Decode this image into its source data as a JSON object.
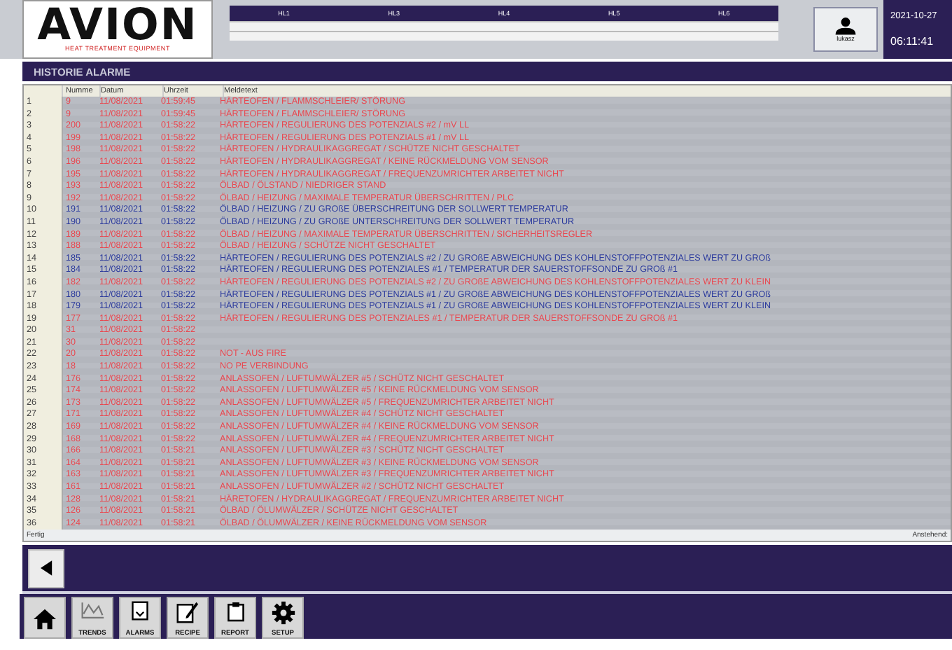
{
  "header": {
    "logo": {
      "name": "AVION",
      "tagline": "HEAT TREATMENT EQUIPMENT"
    },
    "hl_table": {
      "columns": [
        "HL1",
        "HL3",
        "HL4",
        "HL5",
        "HL6"
      ]
    },
    "user_button": {
      "label": "lukasz"
    },
    "clock": {
      "date": "2021-10-27",
      "time": "06:11:41"
    }
  },
  "page_title": "HISTORIE ALARME",
  "table": {
    "columns": [
      "Numme",
      "Datum",
      "Uhrzeit",
      "Meldetext"
    ],
    "rows": [
      {
        "index": "1",
        "number": "9",
        "date": "11/08/2021",
        "time": "01:59:45",
        "text": "HÄRTEOFEN / FLAMMSCHLEIER/ STÖRUNG",
        "color": "#e8474f"
      },
      {
        "index": "2",
        "number": "9",
        "date": "11/08/2021",
        "time": "01:59:45",
        "text": "HÄRTEOFEN / FLAMMSCHLEIER/ STÖRUNG",
        "color": "#e8474f"
      },
      {
        "index": "3",
        "number": "200",
        "date": "11/08/2021",
        "time": "01:58:22",
        "text": "HÄRTEOFEN / REGULIERUNG DES POTENZIALS #2 / mV LL",
        "color": "#e8474f"
      },
      {
        "index": "4",
        "number": "199",
        "date": "11/08/2021",
        "time": "01:58:22",
        "text": "HÄRTEOFEN / REGULIERUNG DES POTENZIALS #1 / mV LL",
        "color": "#e8474f"
      },
      {
        "index": "5",
        "number": "198",
        "date": "11/08/2021",
        "time": "01:58:22",
        "text": "HÄRTEOFEN / HYDRAULIKAGGREGAT / SCHÜTZE NICHT GESCHALTET",
        "color": "#e8474f"
      },
      {
        "index": "6",
        "number": "196",
        "date": "11/08/2021",
        "time": "01:58:22",
        "text": "HÄRTEOFEN / HYDRAULIKAGGREGAT / KEINE RÜCKMELDUNG VOM SENSOR",
        "color": "#e8474f"
      },
      {
        "index": "7",
        "number": "195",
        "date": "11/08/2021",
        "time": "01:58:22",
        "text": "HÄRTEOFEN / HYDRAULIKAGGREGAT / FREQUENZUMRICHTER ARBEITET NICHT",
        "color": "#e8474f"
      },
      {
        "index": "8",
        "number": "193",
        "date": "11/08/2021",
        "time": "01:58:22",
        "text": "ÖLBAD / ÖLSTAND / NIEDRIGER STAND",
        "color": "#e8474f"
      },
      {
        "index": "9",
        "number": "192",
        "date": "11/08/2021",
        "time": "01:58:22",
        "text": "ÖLBAD / HEIZUNG / MAXIMALE TEMPERATUR ÜBERSCHRITTEN / PLC",
        "color": "#e8474f"
      },
      {
        "index": "10",
        "number": "191",
        "date": "11/08/2021",
        "time": "01:58:22",
        "text": "ÖLBAD / HEIZUNG / ZU GROßE ÜBERSCHREITUNG DER SOLLWERT TEMPERATUR",
        "color": "#2b3a9c"
      },
      {
        "index": "11",
        "number": "190",
        "date": "11/08/2021",
        "time": "01:58:22",
        "text": "ÖLBAD / HEIZUNG / ZU GROßE UNTERSCHREITUNG DER SOLLWERT TEMPERATUR",
        "color": "#2b3a9c"
      },
      {
        "index": "12",
        "number": "189",
        "date": "11/08/2021",
        "time": "01:58:22",
        "text": "ÖLBAD / HEIZUNG / MAXIMALE TEMPERATUR ÜBERSCHRITTEN / SICHERHEITSREGLER",
        "color": "#e8474f"
      },
      {
        "index": "13",
        "number": "188",
        "date": "11/08/2021",
        "time": "01:58:22",
        "text": "ÖLBAD / HEIZUNG / SCHÜTZE NICHT GESCHALTET",
        "color": "#e8474f"
      },
      {
        "index": "14",
        "number": "185",
        "date": "11/08/2021",
        "time": "01:58:22",
        "text": "HÄRTEOFEN / REGULIERUNG DES POTENZIALS #2 / ZU GROßE ABWEICHUNG DES KOHLENSTOFFPOTENZIALES WERT ZU GROß",
        "color": "#2b3a9c"
      },
      {
        "index": "15",
        "number": "184",
        "date": "11/08/2021",
        "time": "01:58:22",
        "text": "HÄRTEOFEN / REGULIERUNG DES POTENZIALES #1 / TEMPERATUR DER SAUERSTOFFSONDE ZU GROß #1",
        "color": "#2b3a9c"
      },
      {
        "index": "16",
        "number": "182",
        "date": "11/08/2021",
        "time": "01:58:22",
        "text": "HÄRTEOFEN / REGULIERUNG DES POTENZIALS #2 / ZU GROßE ABWEICHUNG DES KOHLENSTOFFPOTENZIALES WERT ZU KLEIN",
        "color": "#e8474f"
      },
      {
        "index": "17",
        "number": "180",
        "date": "11/08/2021",
        "time": "01:58:22",
        "text": "HÄRTEOFEN / REGULIERUNG DES POTENZIALS #1 / ZU GROßE ABWEICHUNG DES KOHLENSTOFFPOTENZIALES WERT ZU GROß",
        "color": "#2b3a9c"
      },
      {
        "index": "18",
        "number": "179",
        "date": "11/08/2021",
        "time": "01:58:22",
        "text": "HÄRTEOFEN / REGULIERUNG DES POTENZIALS #1 / ZU GROßE ABWEICHUNG DES KOHLENSTOFFPOTENZIALES WERT ZU KLEIN",
        "color": "#2b3a9c"
      },
      {
        "index": "19",
        "number": "177",
        "date": "11/08/2021",
        "time": "01:58:22",
        "text": "HÄRTEOFEN / REGULIERUNG DES POTENZIALES #1 / TEMPERATUR DER SAUERSTOFFSONDE ZU GROß #1",
        "color": "#e8474f"
      },
      {
        "index": "20",
        "number": "31",
        "date": "11/08/2021",
        "time": "01:58:22",
        "color": "#e8474f"
      },
      {
        "index": "21",
        "number": "30",
        "date": "11/08/2021",
        "time": "01:58:22",
        "color": "#e8474f"
      },
      {
        "index": "22",
        "number": "20",
        "date": "11/08/2021",
        "time": "01:58:22",
        "text": "NOT - AUS FIRE",
        "color": "#e8474f"
      },
      {
        "index": "23",
        "number": "18",
        "date": "11/08/2021",
        "time": "01:58:22",
        "text": "NO PE VERBINDUNG",
        "color": "#e8474f"
      },
      {
        "index": "24",
        "number": "176",
        "date": "11/08/2021",
        "time": "01:58:22",
        "text": "ANLASSOFEN / LUFTUMWÄLZER #5 / SCHÜTZ NICHT GESCHALTET",
        "color": "#e8474f"
      },
      {
        "index": "25",
        "number": "174",
        "date": "11/08/2021",
        "time": "01:58:22",
        "text": "ANLASSOFEN / LUFTUMWÄLZER #5 / KEINE RÜCKMELDUNG VOM SENSOR",
        "color": "#e8474f"
      },
      {
        "index": "26",
        "number": "173",
        "date": "11/08/2021",
        "time": "01:58:22",
        "text": "ANLASSOFEN / LUFTUMWÄLZER #5 / FREQUENZUMRICHTER ARBEITET NICHT",
        "color": "#e8474f"
      },
      {
        "index": "27",
        "number": "171",
        "date": "11/08/2021",
        "time": "01:58:22",
        "text": "ANLASSOFEN / LUFTUMWÄLZER #4 / SCHÜTZ NICHT GESCHALTET",
        "color": "#e8474f"
      },
      {
        "index": "28",
        "number": "169",
        "date": "11/08/2021",
        "time": "01:58:22",
        "text": "ANLASSOFEN / LUFTUMWÄLZER #4 / KEINE RÜCKMELDUNG VOM SENSOR",
        "color": "#e8474f"
      },
      {
        "index": "29",
        "number": "168",
        "date": "11/08/2021",
        "time": "01:58:22",
        "text": "ANLASSOFEN / LUFTUMWÄLZER #4 / FREQUENZUMRICHTER ARBEITET NICHT",
        "color": "#e8474f"
      },
      {
        "index": "30",
        "number": "166",
        "date": "11/08/2021",
        "time": "01:58:21",
        "text": "ANLASSOFEN / LUFTUMWÄLZER #3 / SCHÜTZ NICHT GESCHALTET",
        "color": "#e8474f"
      },
      {
        "index": "31",
        "number": "164",
        "date": "11/08/2021",
        "time": "01:58:21",
        "text": "ANLASSOFEN / LUFTUMWÄLZER #3 / KEINE RÜCKMELDUNG VOM SENSOR",
        "color": "#e8474f"
      },
      {
        "index": "32",
        "number": "163",
        "date": "11/08/2021",
        "time": "01:58:21",
        "text": "ANLASSOFEN / LUFTUMWÄLZER #3 / FREQUENZUMRICHTER ARBEITET NICHT",
        "color": "#e8474f"
      },
      {
        "index": "33",
        "number": "161",
        "date": "11/08/2021",
        "time": "01:58:21",
        "text": "ANLASSOFEN / LUFTUMWÄLZER #2 / SCHÜTZ NICHT GESCHALTET",
        "color": "#e8474f"
      },
      {
        "index": "34",
        "number": "128",
        "date": "11/08/2021",
        "time": "01:58:21",
        "text": "HÄRETOFEN / HYDRAULIKAGGREGAT / FREQUENZUMRICHTER ARBEITET NICHT",
        "color": "#e8474f"
      },
      {
        "index": "35",
        "number": "126",
        "date": "11/08/2021",
        "time": "01:58:21",
        "text": "ÖLBAD / ÖLUMWÄLZER / SCHÜTZE NICHT GESCHALTET",
        "color": "#e8474f"
      },
      {
        "index": "36",
        "number": "124",
        "date": "11/08/2021",
        "time": "01:58:21",
        "text": "ÖLBAD / ÖLUMWÄLZER / KEINE RÜCKMELDUNG VOM SENSOR",
        "color": "#e8474f"
      }
    ]
  },
  "status_bar": {
    "left": "Fertig",
    "right": "Anstehend:"
  },
  "nav": [
    {
      "kind": "home"
    },
    {
      "kind": "trends",
      "label": "TRENDS"
    },
    {
      "kind": "alarms",
      "label": "ALARMS"
    },
    {
      "kind": "recipe",
      "label": "RECIPE"
    },
    {
      "kind": "report",
      "label": "REPORT"
    },
    {
      "kind": "setup",
      "label": "SETUP"
    }
  ]
}
